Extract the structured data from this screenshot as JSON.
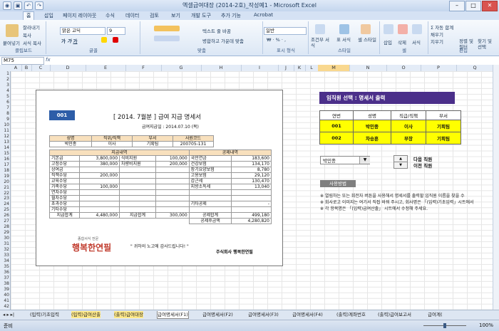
{
  "window": {
    "title": "엑셀급여대장 (2014-2호)_작성예1 - Microsoft Excel"
  },
  "ribbon_tabs": [
    "홈",
    "삽입",
    "페이지 레이아웃",
    "수식",
    "데이터",
    "검토",
    "보기",
    "개발 도구",
    "추가 기능",
    "Acrobat"
  ],
  "ribbon": {
    "paste": "붙여넣기",
    "cut": "잘라내기",
    "copy": "복사",
    "format_painter": "서식 복사",
    "clipboard": "클립보드",
    "font_name": "맑은 고딕",
    "font_size": "9",
    "font_group": "글꼴",
    "wrap_text": "텍스트 줄 바꿈",
    "merge_center": "병합하고 가운데 맞춤",
    "align_group": "맞춤",
    "number_format": "일반",
    "number_group": "표시 형식",
    "cond_format": "조건부 서식",
    "table_format": "표 서식",
    "cell_style": "셀 스타일",
    "style_group": "스타일",
    "insert": "삽입",
    "delete": "삭제",
    "format": "서식",
    "cells_group": "셀",
    "autosum": "자동 합계",
    "fill": "채우기",
    "clear": "지우기",
    "sort_filter": "정렬 및 필터",
    "find_select": "찾기 및 선택",
    "edit_group": "편집"
  },
  "namebox": "M75",
  "columns": [
    "A",
    "B",
    "C",
    "D",
    "E",
    "F",
    "G",
    "H",
    "I",
    "J",
    "K",
    "L",
    "M",
    "N",
    "O",
    "P",
    "Q"
  ],
  "selected_column": "M",
  "rows": [
    "1",
    "2",
    "3",
    "4",
    "5",
    "6",
    "7",
    "8",
    "9",
    "10",
    "11",
    "12",
    "13",
    "14",
    "15",
    "16",
    "17",
    "18",
    "19",
    "20",
    "21",
    "22",
    "23",
    "24",
    "25",
    "26",
    "27",
    "28",
    "29",
    "30",
    "31",
    "32",
    "33",
    "34",
    "35",
    "36",
    "37",
    "38",
    "39",
    "40",
    "41",
    "42"
  ],
  "payslip": {
    "number": "001",
    "title": "[ 2014. 7월분 ]  급여 지급 명세서",
    "pay_date": "급여지급일 : 2014.07.10 (목)",
    "info_headers": [
      "성명",
      "직위/직책",
      "부서",
      "사원코드"
    ],
    "info_values": [
      "박민종",
      "이사",
      "기획팀",
      "200705-131"
    ],
    "section_pay": "지급내역",
    "section_deduct": "공제내역",
    "pay_items": [
      [
        "기본급",
        "3,800,000",
        "식비지원",
        "100,000"
      ],
      [
        "고정수당",
        "380,000",
        "차량비지원",
        "200,000"
      ],
      [
        "상여금",
        "",
        "",
        ""
      ],
      [
        "직책수당",
        "200,000",
        "",
        ""
      ],
      [
        "교육수당",
        "",
        "",
        ""
      ],
      [
        "가족수당",
        "100,000",
        "",
        ""
      ],
      [
        "연차수당",
        "",
        "",
        ""
      ],
      [
        "월차수당",
        "",
        "",
        ""
      ],
      [
        "초과수당",
        "",
        "",
        ""
      ],
      [
        "기타수당",
        "",
        "",
        ""
      ]
    ],
    "deduct_items": [
      [
        "국민연금",
        "183,600"
      ],
      [
        "건강보험",
        "134,170"
      ],
      [
        "장기요양보험",
        "8,780"
      ],
      [
        "고용보험",
        "29,120"
      ],
      [
        "갑근세",
        "130,470"
      ],
      [
        "지방소득세",
        "13,040"
      ],
      [
        "",
        ""
      ],
      [
        "",
        ""
      ],
      [
        "기타공제",
        "-"
      ],
      [
        "",
        ""
      ]
    ],
    "total_pay_label": "지급합계",
    "total_pay": "4,480,000",
    "total_pay2_label": "지급합계",
    "total_pay2": "300,000",
    "total_deduct_label": "공제합계",
    "total_deduct": "499,180",
    "net_label": "공제후금액",
    "net_value": "4,280,820",
    "thanks": "\" 귀하의 노고에 감사드립니다! \"",
    "company": "주식회사 행복한연필",
    "logo_small": "종합서식 전문",
    "logo_big": "행복한연필"
  },
  "selector": {
    "title": "임직원 선택 : 명세서 출력",
    "headers": [
      "연번",
      "성명",
      "직급/직책",
      "부서"
    ],
    "rows": [
      [
        "001",
        "박민종",
        "이사",
        "기획팀"
      ],
      [
        "002",
        "차승훈",
        "부장",
        "기획팀"
      ]
    ],
    "dropdown_value": "박민종",
    "next_label": "다음 직원",
    "prev_label": "이전 직원",
    "usage_label": "사용방법",
    "notes": [
      "※ 열림하는 또는 회전자 버튼을 사용해서 명세서를 출력할 임직원 이름을 찾을 수",
      "※ 회사로고 이미지는 여기서 직접 바꿔 주시고, 회사명은 「(입력)기초입력」시트에서",
      "※ 각 항목명은 「(입력)급여산출」 시트에서 수정해 주세요."
    ]
  },
  "sheet_tabs": [
    "(입력)기초입력",
    "(입력)급여산출",
    "(출력)급여대장",
    "급여명세서(F1)",
    "급여명세서(F2)",
    "급여명세서(F3)",
    "급여명세서(F4)",
    "(출력)계좌번호",
    "(출력)급여보고서",
    "급여계("
  ],
  "status": {
    "ready": "준비",
    "zoom": "100%"
  }
}
